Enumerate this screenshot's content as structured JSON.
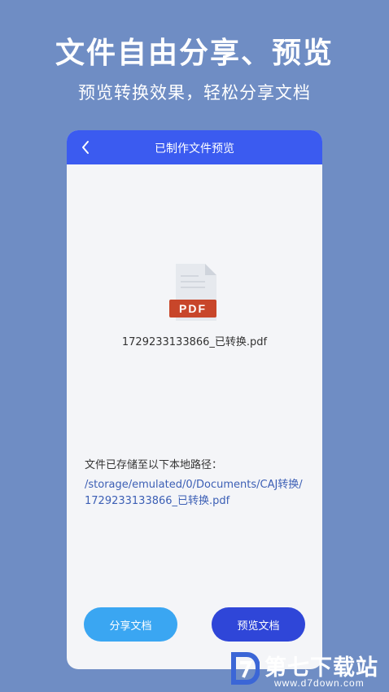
{
  "promo": {
    "headline": "文件自由分享、预览",
    "subheadline": "预览转换效果，轻松分享文档"
  },
  "appbar": {
    "title": "已制作文件预览",
    "back_icon": "chevron-left-icon"
  },
  "file": {
    "icon": "pdf-file-icon",
    "badge": "PDF",
    "name": "1729233133866_已转换.pdf"
  },
  "storage": {
    "label": "文件已存储至以下本地路径：",
    "path": "/storage/emulated/0/Documents/CAJ转换/1729233133866_已转换.pdf"
  },
  "actions": {
    "share_label": "分享文档",
    "preview_label": "预览文档"
  },
  "watermark": {
    "title": "第七下载站",
    "url": "www.d7down.com"
  },
  "colors": {
    "background": "#6f8dc4",
    "appbar": "#3b5bf0",
    "share_button": "#3aa6f2",
    "preview_button": "#2f46d8",
    "path_text": "#3c5fb5",
    "pdf_badge": "#c8462a"
  }
}
